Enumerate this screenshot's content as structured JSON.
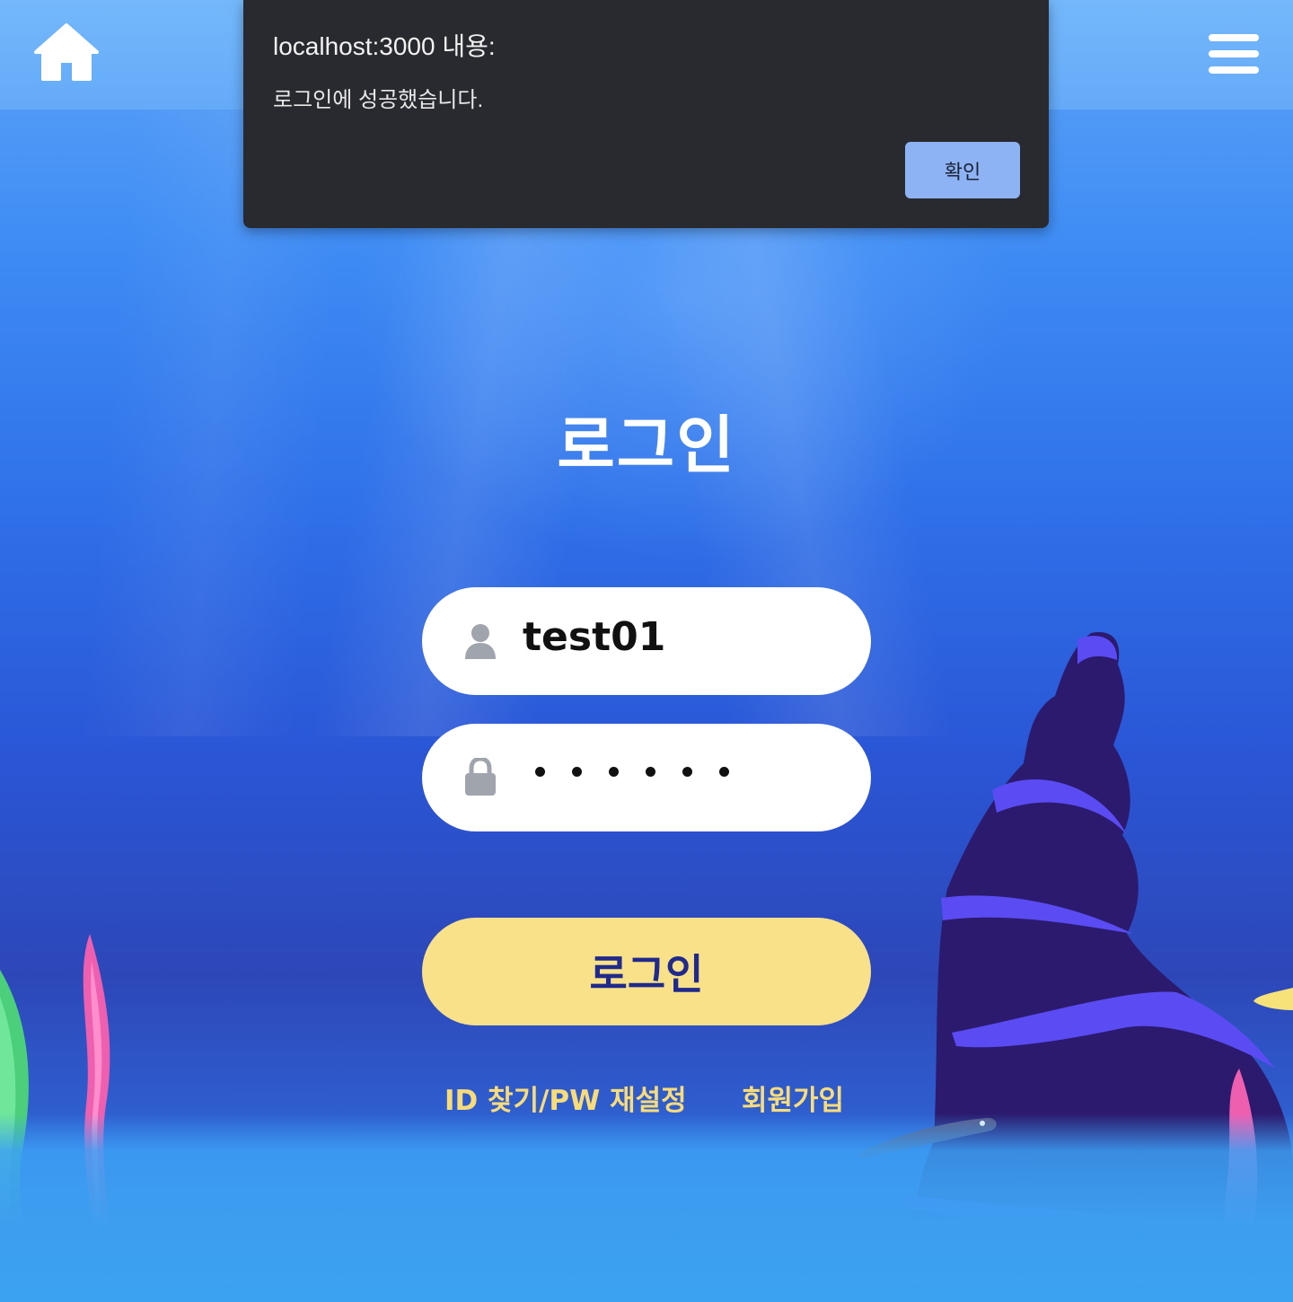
{
  "header": {
    "home_icon": "home-icon",
    "menu_icon": "hamburger-menu-icon"
  },
  "dialog": {
    "title": "localhost:3000 내용:",
    "message": "로그인에 성공했습니다.",
    "ok_label": "확인"
  },
  "login": {
    "title": "로그인",
    "user_icon": "user-icon",
    "username_value": "test01",
    "lock_icon": "lock-icon",
    "password_masked": "••••••",
    "submit_label": "로그인",
    "find_link": "ID 찾기/PW 재설정",
    "signup_link": "회원가입"
  },
  "colors": {
    "button_yellow": "#f9e18a",
    "button_text": "#1f2a8c",
    "link_yellow": "#f9dc7a",
    "dialog_bg": "#292a2f",
    "dialog_button": "#8eb3f4"
  }
}
